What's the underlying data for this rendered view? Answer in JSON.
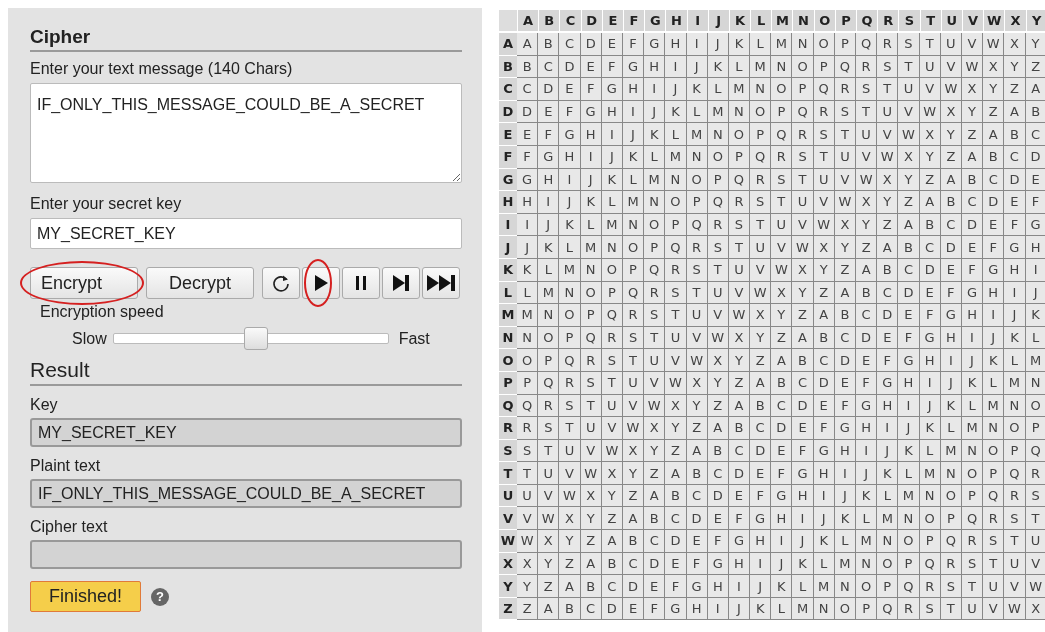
{
  "cipher": {
    "title": "Cipher",
    "message_label": "Enter your text message (140 Chars)",
    "message": "IF_ONLY_THIS_MESSAGE_COULD_BE_A_SECRET",
    "key_label": "Enter your secret key",
    "key": "MY_SECRET_KEY",
    "controls": [
      {
        "kind": "text",
        "label": "Encrypt",
        "circled": true
      },
      {
        "kind": "text",
        "label": "Decrypt",
        "circled": false
      },
      {
        "kind": "reload",
        "circled": false
      },
      {
        "kind": "play",
        "circled": true
      },
      {
        "kind": "pause",
        "circled": false
      },
      {
        "kind": "step",
        "circled": false
      },
      {
        "kind": "end",
        "circled": false
      }
    ],
    "speed": {
      "label": "Encryption speed",
      "min_label": "Slow",
      "max_label": "Fast",
      "level": 0.52
    }
  },
  "result": {
    "title": "Result",
    "fields": [
      {
        "label": "Key",
        "value": "MY_SECRET_KEY"
      },
      {
        "label": "Plaint text",
        "value": "IF_ONLY_THIS_MESSAGE_COULD_BE_A_SECRET"
      },
      {
        "label": "Cipher text"
      }
    ],
    "status": "Finished!",
    "help": "?"
  },
  "tableau": {
    "columns": [
      "A",
      "B",
      "C",
      "D",
      "E",
      "F",
      "G",
      "H",
      "I",
      "J",
      "K",
      "L",
      "M",
      "N",
      "O",
      "P",
      "Q",
      "R",
      "S",
      "T",
      "U",
      "V",
      "W",
      "X",
      "Y"
    ],
    "rows": [
      {
        "label": "A",
        "cells": [
          "A",
          "B",
          "C",
          "D",
          "E",
          "F",
          "G",
          "H",
          "I",
          "J",
          "K",
          "L",
          "M",
          "N",
          "O",
          "P",
          "Q",
          "R",
          "S",
          "T",
          "U",
          "V",
          "W",
          "X",
          "Y"
        ]
      },
      {
        "label": "B",
        "cells": [
          "B",
          "C",
          "D",
          "E",
          "F",
          "G",
          "H",
          "I",
          "J",
          "K",
          "L",
          "M",
          "N",
          "O",
          "P",
          "Q",
          "R",
          "S",
          "T",
          "U",
          "V",
          "W",
          "X",
          "Y",
          "Z"
        ]
      },
      {
        "label": "C",
        "cells": [
          "C",
          "D",
          "E",
          "F",
          "G",
          "H",
          "I",
          "J",
          "K",
          "L",
          "M",
          "N",
          "O",
          "P",
          "Q",
          "R",
          "S",
          "T",
          "U",
          "V",
          "W",
          "X",
          "Y",
          "Z",
          "A"
        ]
      },
      {
        "label": "D",
        "cells": [
          "D",
          "E",
          "F",
          "G",
          "H",
          "I",
          "J",
          "K",
          "L",
          "M",
          "N",
          "O",
          "P",
          "Q",
          "R",
          "S",
          "T",
          "U",
          "V",
          "W",
          "X",
          "Y",
          "Z",
          "A",
          "B"
        ]
      },
      {
        "label": "E",
        "cells": [
          "E",
          "F",
          "G",
          "H",
          "I",
          "J",
          "K",
          "L",
          "M",
          "N",
          "O",
          "P",
          "Q",
          "R",
          "S",
          "T",
          "U",
          "V",
          "W",
          "X",
          "Y",
          "Z",
          "A",
          "B",
          "C"
        ]
      },
      {
        "label": "F",
        "cells": [
          "F",
          "G",
          "H",
          "I",
          "J",
          "K",
          "L",
          "M",
          "N",
          "O",
          "P",
          "Q",
          "R",
          "S",
          "T",
          "U",
          "V",
          "W",
          "X",
          "Y",
          "Z",
          "A",
          "B",
          "C",
          "D"
        ]
      },
      {
        "label": "G",
        "cells": [
          "G",
          "H",
          "I",
          "J",
          "K",
          "L",
          "M",
          "N",
          "O",
          "P",
          "Q",
          "R",
          "S",
          "T",
          "U",
          "V",
          "W",
          "X",
          "Y",
          "Z",
          "A",
          "B",
          "C",
          "D",
          "E"
        ]
      },
      {
        "label": "H",
        "cells": [
          "H",
          "I",
          "J",
          "K",
          "L",
          "M",
          "N",
          "O",
          "P",
          "Q",
          "R",
          "S",
          "T",
          "U",
          "V",
          "W",
          "X",
          "Y",
          "Z",
          "A",
          "B",
          "C",
          "D",
          "E",
          "F"
        ]
      },
      {
        "label": "I",
        "cells": [
          "I",
          "J",
          "K",
          "L",
          "M",
          "N",
          "O",
          "P",
          "Q",
          "R",
          "S",
          "T",
          "U",
          "V",
          "W",
          "X",
          "Y",
          "Z",
          "A",
          "B",
          "C",
          "D",
          "E",
          "F",
          "G"
        ]
      },
      {
        "label": "J",
        "cells": [
          "J",
          "K",
          "L",
          "M",
          "N",
          "O",
          "P",
          "Q",
          "R",
          "S",
          "T",
          "U",
          "V",
          "W",
          "X",
          "Y",
          "Z",
          "A",
          "B",
          "C",
          "D",
          "E",
          "F",
          "G",
          "H"
        ]
      },
      {
        "label": "K",
        "cells": [
          "K",
          "L",
          "M",
          "N",
          "O",
          "P",
          "Q",
          "R",
          "S",
          "T",
          "U",
          "V",
          "W",
          "X",
          "Y",
          "Z",
          "A",
          "B",
          "C",
          "D",
          "E",
          "F",
          "G",
          "H",
          "I"
        ]
      },
      {
        "label": "L",
        "cells": [
          "L",
          "M",
          "N",
          "O",
          "P",
          "Q",
          "R",
          "S",
          "T",
          "U",
          "V",
          "W",
          "X",
          "Y",
          "Z",
          "A",
          "B",
          "C",
          "D",
          "E",
          "F",
          "G",
          "H",
          "I",
          "J"
        ]
      },
      {
        "label": "M",
        "cells": [
          "M",
          "N",
          "O",
          "P",
          "Q",
          "R",
          "S",
          "T",
          "U",
          "V",
          "W",
          "X",
          "Y",
          "Z",
          "A",
          "B",
          "C",
          "D",
          "E",
          "F",
          "G",
          "H",
          "I",
          "J",
          "K"
        ]
      },
      {
        "label": "N",
        "cells": [
          "N",
          "O",
          "P",
          "Q",
          "R",
          "S",
          "T",
          "U",
          "V",
          "W",
          "X",
          "Y",
          "Z",
          "A",
          "B",
          "C",
          "D",
          "E",
          "F",
          "G",
          "H",
          "I",
          "J",
          "K",
          "L"
        ]
      },
      {
        "label": "O",
        "cells": [
          "O",
          "P",
          "Q",
          "R",
          "S",
          "T",
          "U",
          "V",
          "W",
          "X",
          "Y",
          "Z",
          "A",
          "B",
          "C",
          "D",
          "E",
          "F",
          "G",
          "H",
          "I",
          "J",
          "K",
          "L",
          "M"
        ]
      },
      {
        "label": "P",
        "cells": [
          "P",
          "Q",
          "R",
          "S",
          "T",
          "U",
          "V",
          "W",
          "X",
          "Y",
          "Z",
          "A",
          "B",
          "C",
          "D",
          "E",
          "F",
          "G",
          "H",
          "I",
          "J",
          "K",
          "L",
          "M",
          "N"
        ]
      },
      {
        "label": "Q",
        "cells": [
          "Q",
          "R",
          "S",
          "T",
          "U",
          "V",
          "W",
          "X",
          "Y",
          "Z",
          "A",
          "B",
          "C",
          "D",
          "E",
          "F",
          "G",
          "H",
          "I",
          "J",
          "K",
          "L",
          "M",
          "N",
          "O"
        ]
      },
      {
        "label": "R",
        "cells": [
          "R",
          "S",
          "T",
          "U",
          "V",
          "W",
          "X",
          "Y",
          "Z",
          "A",
          "B",
          "C",
          "D",
          "E",
          "F",
          "G",
          "H",
          "I",
          "J",
          "K",
          "L",
          "M",
          "N",
          "O",
          "P"
        ]
      },
      {
        "label": "S",
        "cells": [
          "S",
          "T",
          "U",
          "V",
          "W",
          "X",
          "Y",
          "Z",
          "A",
          "B",
          "C",
          "D",
          "E",
          "F",
          "G",
          "H",
          "I",
          "J",
          "K",
          "L",
          "M",
          "N",
          "O",
          "P",
          "Q"
        ]
      },
      {
        "label": "T",
        "cells": [
          "T",
          "U",
          "V",
          "W",
          "X",
          "Y",
          "Z",
          "A",
          "B",
          "C",
          "D",
          "E",
          "F",
          "G",
          "H",
          "I",
          "J",
          "K",
          "L",
          "M",
          "N",
          "O",
          "P",
          "Q",
          "R"
        ]
      },
      {
        "label": "U",
        "cells": [
          "U",
          "V",
          "W",
          "X",
          "Y",
          "Z",
          "A",
          "B",
          "C",
          "D",
          "E",
          "F",
          "G",
          "H",
          "I",
          "J",
          "K",
          "L",
          "M",
          "N",
          "O",
          "P",
          "Q",
          "R",
          "S"
        ]
      },
      {
        "label": "V",
        "cells": [
          "V",
          "W",
          "X",
          "Y",
          "Z",
          "A",
          "B",
          "C",
          "D",
          "E",
          "F",
          "G",
          "H",
          "I",
          "J",
          "K",
          "L",
          "M",
          "N",
          "O",
          "P",
          "Q",
          "R",
          "S",
          "T"
        ]
      },
      {
        "label": "W",
        "cells": [
          "W",
          "X",
          "Y",
          "Z",
          "A",
          "B",
          "C",
          "D",
          "E",
          "F",
          "G",
          "H",
          "I",
          "J",
          "K",
          "L",
          "M",
          "N",
          "O",
          "P",
          "Q",
          "R",
          "S",
          "T",
          "U"
        ]
      },
      {
        "label": "X",
        "cells": [
          "X",
          "Y",
          "Z",
          "A",
          "B",
          "C",
          "D",
          "E",
          "F",
          "G",
          "H",
          "I",
          "J",
          "K",
          "L",
          "M",
          "N",
          "O",
          "P",
          "Q",
          "R",
          "S",
          "T",
          "U",
          "V"
        ]
      },
      {
        "label": "Y",
        "cells": [
          "Y",
          "Z",
          "A",
          "B",
          "C",
          "D",
          "E",
          "F",
          "G",
          "H",
          "I",
          "J",
          "K",
          "L",
          "M",
          "N",
          "O",
          "P",
          "Q",
          "R",
          "S",
          "T",
          "U",
          "V",
          "W"
        ]
      },
      {
        "label": "Z",
        "cells": [
          "Z",
          "A",
          "B",
          "C",
          "D",
          "E",
          "F",
          "G",
          "H",
          "I",
          "J",
          "K",
          "L",
          "M",
          "N",
          "O",
          "P",
          "Q",
          "R",
          "S",
          "T",
          "U",
          "V",
          "W",
          "X"
        ]
      }
    ]
  }
}
